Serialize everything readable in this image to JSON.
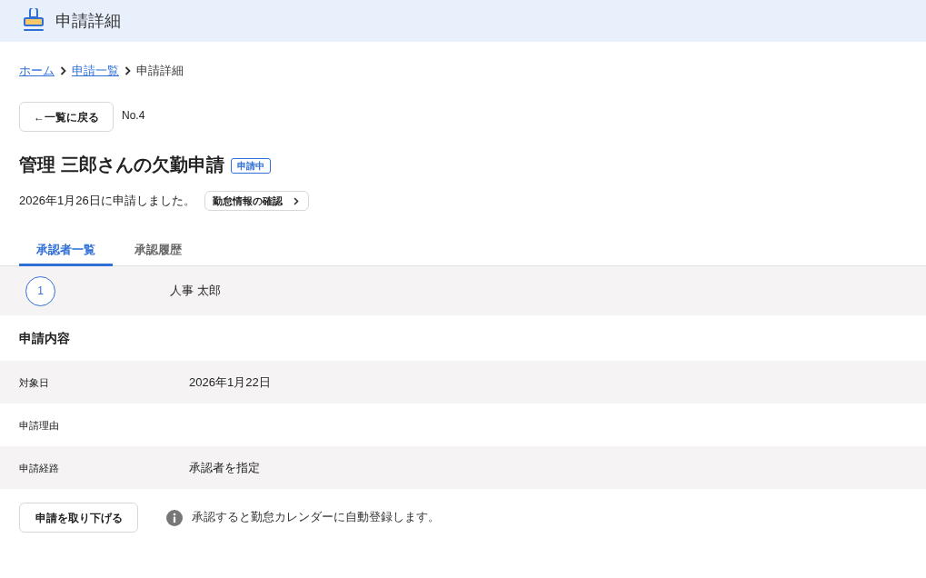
{
  "header": {
    "title": "申請詳細"
  },
  "breadcrumb": [
    {
      "label": "ホーム",
      "kind": "link"
    },
    {
      "label": "申請一覧",
      "kind": "link"
    },
    {
      "label": "申請詳細",
      "kind": "current"
    }
  ],
  "back_button": {
    "label": "←一覧に戻る"
  },
  "request_number": "No.4",
  "title": "管理 三郎さんの欠勤申請",
  "status_badge": "申請中",
  "submitted_text": "2026年1月26日に申請しました。",
  "attendance_button": {
    "label": "勤怠情報の確認"
  },
  "tabs": [
    {
      "label": "承認者一覧",
      "selected": true
    },
    {
      "label": "承認履歴",
      "selected": false
    }
  ],
  "approvers": [
    {
      "step": "1",
      "name": "人事 太郎"
    }
  ],
  "section_title": "申請内容",
  "details": [
    {
      "label": "対象日",
      "value": "2026年1月22日"
    },
    {
      "label": "申請理由"
    },
    {
      "label": "申請経路",
      "value": "承認者を指定"
    }
  ],
  "withdraw_button": {
    "label": "申請を取り下げる"
  },
  "notice": "承認すると勤怠カレンダーに自動登録します。"
}
